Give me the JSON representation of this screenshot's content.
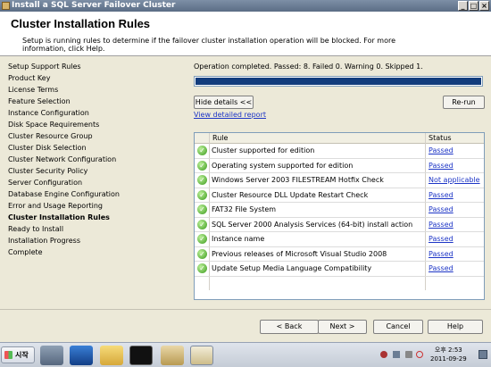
{
  "window": {
    "title": "Install a SQL Server Failover Cluster"
  },
  "header": {
    "title": "Cluster Installation Rules",
    "description": "Setup is running rules to determine if the failover cluster installation operation will be blocked. For more information, click Help."
  },
  "sidebar": {
    "items": [
      {
        "label": "Setup Support Rules",
        "active": false
      },
      {
        "label": "Product Key",
        "active": false
      },
      {
        "label": "License Terms",
        "active": false
      },
      {
        "label": "Feature Selection",
        "active": false
      },
      {
        "label": "Instance Configuration",
        "active": false
      },
      {
        "label": "Disk Space Requirements",
        "active": false
      },
      {
        "label": "Cluster Resource Group",
        "active": false
      },
      {
        "label": "Cluster Disk Selection",
        "active": false
      },
      {
        "label": "Cluster Network Configuration",
        "active": false
      },
      {
        "label": "Cluster Security Policy",
        "active": false
      },
      {
        "label": "Server Configuration",
        "active": false
      },
      {
        "label": "Database Engine Configuration",
        "active": false
      },
      {
        "label": "Error and Usage Reporting",
        "active": false
      },
      {
        "label": "Cluster Installation Rules",
        "active": true
      },
      {
        "label": "Ready to Install",
        "active": false
      },
      {
        "label": "Installation Progress",
        "active": false
      },
      {
        "label": "Complete",
        "active": false
      }
    ]
  },
  "main": {
    "status": "Operation completed. Passed: 8.   Failed 0.   Warning 0.   Skipped 1.",
    "progress": 1.0,
    "progress_color": "#123c7c",
    "hide_details_label": "Hide details <<",
    "rerun_label": "Re-run",
    "view_report_label": "View detailed report",
    "table": {
      "columns": [
        "Rule",
        "Status"
      ],
      "rows": [
        {
          "rule": "Cluster supported for edition",
          "status": "Passed"
        },
        {
          "rule": "Operating system supported for edition",
          "status": "Passed"
        },
        {
          "rule": "Windows Server 2003 FILESTREAM Hotfix Check",
          "status": "Not applicable"
        },
        {
          "rule": "Cluster Resource DLL Update Restart Check",
          "status": "Passed"
        },
        {
          "rule": "FAT32 File System",
          "status": "Passed"
        },
        {
          "rule": "SQL Server 2000 Analysis Services (64-bit) install action",
          "status": "Passed"
        },
        {
          "rule": "Instance name",
          "status": "Passed"
        },
        {
          "rule": "Previous releases of Microsoft Visual Studio 2008",
          "status": "Passed"
        },
        {
          "rule": "Update Setup Media Language Compatibility",
          "status": "Passed"
        }
      ]
    }
  },
  "footer": {
    "back_label": "< Back",
    "next_label": "Next >",
    "cancel_label": "Cancel",
    "help_label": "Help"
  },
  "taskbar": {
    "start_label": "시작",
    "time": "오후 2:53",
    "date": "2011-09-29"
  }
}
